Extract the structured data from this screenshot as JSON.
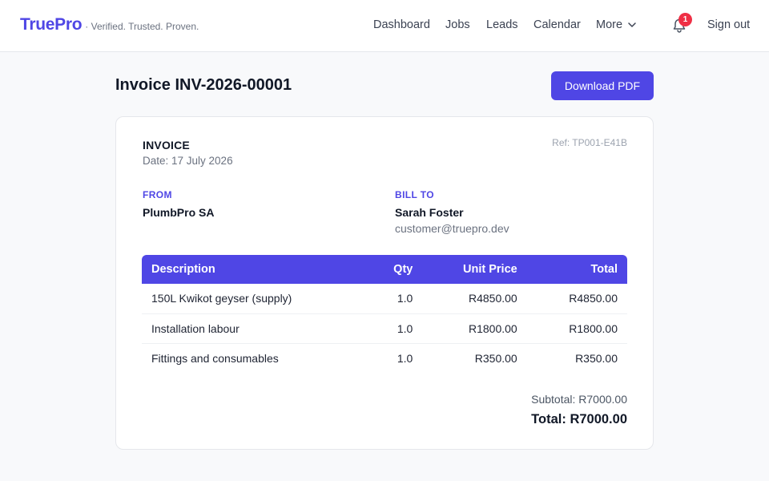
{
  "header": {
    "brand": "TruePro",
    "tagline": "· Verified. Trusted. Proven.",
    "nav": {
      "dashboard": "Dashboard",
      "jobs": "Jobs",
      "leads": "Leads",
      "calendar": "Calendar",
      "more": "More"
    },
    "notification_count": "1",
    "sign_out": "Sign out"
  },
  "page": {
    "title": "Invoice INV-2026-00001",
    "download_label": "Download PDF"
  },
  "invoice": {
    "label": "INVOICE",
    "date": "Date: 17 July 2026",
    "ref": "Ref: TP001-E41B",
    "from_label": "FROM",
    "from_name": "PlumbPro SA",
    "bill_to_label": "BILL TO",
    "bill_to_name": "Sarah Foster",
    "bill_to_email": "customer@truepro.dev",
    "columns": {
      "description": "Description",
      "qty": "Qty",
      "unit_price": "Unit Price",
      "total": "Total"
    },
    "items": [
      {
        "description": "150L Kwikot geyser (supply)",
        "qty": "1.0",
        "unit_price": "R4850.00",
        "total": "R4850.00"
      },
      {
        "description": "Installation labour",
        "qty": "1.0",
        "unit_price": "R1800.00",
        "total": "R1800.00"
      },
      {
        "description": "Fittings and consumables",
        "qty": "1.0",
        "unit_price": "R350.00",
        "total": "R350.00"
      }
    ],
    "subtotal": "Subtotal: R7000.00",
    "total": "Total: R7000.00"
  },
  "colors": {
    "accent": "#4f46e5",
    "badge": "#ef2f45",
    "background": "#f8f9fb"
  },
  "icons": {
    "more_chevron": "chevron-down-icon",
    "notifications": "bell-icon"
  }
}
